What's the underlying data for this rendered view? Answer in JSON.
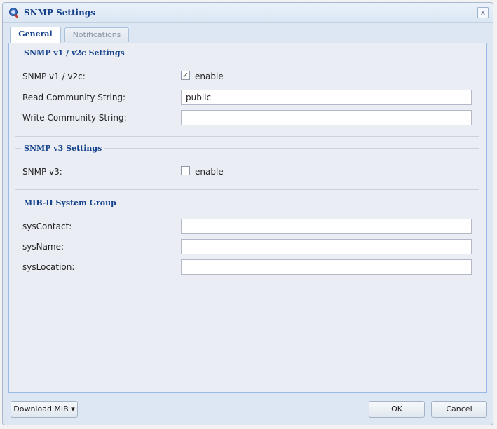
{
  "window": {
    "title": "SNMP Settings",
    "close_glyph": "x"
  },
  "tabs": [
    {
      "label": "General",
      "active": true
    },
    {
      "label": "Notifications",
      "active": false
    }
  ],
  "v1v2c": {
    "legend": "SNMP v1 / v2c Settings",
    "toggle_label": "SNMP v1 / v2c:",
    "enabled": true,
    "enable_text": "enable",
    "read_label": "Read Community String:",
    "read_value": "public",
    "write_label": "Write Community String:",
    "write_value": ""
  },
  "v3": {
    "legend": "SNMP v3 Settings",
    "toggle_label": "SNMP v3:",
    "enabled": false,
    "enable_text": "enable"
  },
  "mib": {
    "legend": "MIB-II System Group",
    "contact_label": "sysContact:",
    "contact_value": "",
    "name_label": "sysName:",
    "name_value": "",
    "location_label": "sysLocation:",
    "location_value": ""
  },
  "footer": {
    "download_label": "Download MIB ▾",
    "ok_label": "OK",
    "cancel_label": "Cancel"
  },
  "icons": {
    "app": "snmp-magnifier-icon",
    "check": "✓"
  },
  "colors": {
    "title": "#15428b",
    "window_bg": "#dde7f3",
    "panel_bg": "#eaeef4"
  }
}
